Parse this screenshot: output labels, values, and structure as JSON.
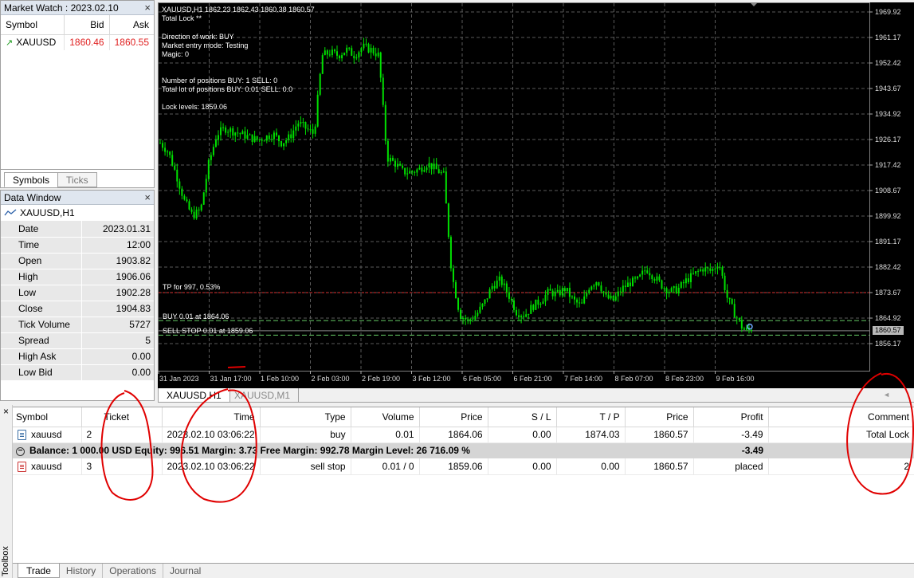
{
  "market_watch": {
    "title": "Market Watch : 2023.02.10",
    "columns": [
      "Symbol",
      "Bid",
      "Ask"
    ],
    "rows": [
      {
        "symbol": "XAUUSD",
        "bid": "1860.46",
        "ask": "1860.55"
      }
    ],
    "tabs": [
      "Symbols",
      "Ticks"
    ]
  },
  "data_window": {
    "title": "Data Window",
    "symbol": "XAUUSD,H1",
    "rows": [
      {
        "key": "Date",
        "value": "2023.01.31"
      },
      {
        "key": "Time",
        "value": "12:00"
      },
      {
        "key": "Open",
        "value": "1903.82"
      },
      {
        "key": "High",
        "value": "1906.06"
      },
      {
        "key": "Low",
        "value": "1902.28"
      },
      {
        "key": "Close",
        "value": "1904.83"
      },
      {
        "key": "Tick Volume",
        "value": "5727"
      },
      {
        "key": "Spread",
        "value": "5"
      },
      {
        "key": "High Ask",
        "value": "0.00"
      },
      {
        "key": "Low Bid",
        "value": "0.00"
      }
    ]
  },
  "chart": {
    "header": "XAUUSD,H1  1862.23 1862.43 1860.38 1860.57",
    "info": {
      "l1": "Total Lock   **",
      "l2": "Direction of work: BUY",
      "l3": "Market entry mode: Testing",
      "l4": "Magic: 0",
      "l5": "Number of positions    BUY: 1    SELL: 0",
      "l6": "Total lot of positions    BUY: 0.01    SELL: 0.0",
      "l7": "Lock levels: 1859.06"
    },
    "levels": {
      "tp": "TP for 997, 0.53%",
      "buy": "BUY 0.01 at 1864.06",
      "sell": "SELL STOP 0.01 at 1859.06",
      "current": "1860.57"
    },
    "tabs": [
      "XAUUSD,H1",
      "XAUUSD,M1"
    ]
  },
  "chart_data": {
    "type": "candlestick",
    "y_ticks": [
      "1969.92",
      "1961.17",
      "1952.42",
      "1943.67",
      "1934.92",
      "1926.17",
      "1917.42",
      "1908.67",
      "1899.92",
      "1891.17",
      "1882.42",
      "1873.67",
      "1864.92",
      "1856.17"
    ],
    "x_ticks": [
      "31 Jan 2023",
      "31 Jan 17:00",
      "1 Feb 10:00",
      "2 Feb 03:00",
      "2 Feb 19:00",
      "3 Feb 12:00",
      "6 Feb 05:00",
      "6 Feb 21:00",
      "7 Feb 14:00",
      "8 Feb 07:00",
      "8 Feb 23:00",
      "9 Feb 16:00"
    ],
    "ylim": [
      1852,
      1973
    ],
    "close_path": [
      1925,
      1922,
      1914,
      1905,
      1900,
      1902,
      1918,
      1928,
      1930,
      1929,
      1928,
      1927,
      1926,
      1927,
      1928,
      1925,
      1927,
      1932,
      1930,
      1928,
      1955,
      1956,
      1955,
      1957,
      1955,
      1958,
      1957,
      1955,
      1920,
      1918,
      1915,
      1915,
      1916,
      1918,
      1916,
      1914,
      1880,
      1866,
      1864,
      1866,
      1870,
      1876,
      1878,
      1873,
      1867,
      1866,
      1869,
      1871,
      1874,
      1873,
      1875,
      1871,
      1869,
      1876,
      1878,
      1872,
      1871,
      1875,
      1877,
      1878,
      1882,
      1879,
      1876,
      1874,
      1875,
      1878,
      1880,
      1882,
      1881,
      1884,
      1872,
      1866,
      1861,
      1860.57
    ],
    "series": [
      {
        "name": "XAUUSD,H1"
      }
    ]
  },
  "trade": {
    "columns": [
      "Symbol",
      "Ticket",
      "Time",
      "Type",
      "Volume",
      "Price",
      "S / L",
      "T / P",
      "Price",
      "Profit",
      "Comment"
    ],
    "rows": [
      {
        "symbol": "xauusd",
        "ticket": "2",
        "time": "2023.02.10 03:06:22",
        "type": "buy",
        "volume": "0.01",
        "price": "1864.06",
        "sl": "0.00",
        "tp": "1874.03",
        "cur": "1860.57",
        "profit": "-3.49",
        "comment": "Total Lock"
      }
    ],
    "balance": "Balance: 1 000.00 USD  Equity: 996.51  Margin: 3.73  Free Margin: 992.78  Margin Level: 26 716.09 %",
    "balance_profit": "-3.49",
    "orders": [
      {
        "symbol": "xauusd",
        "ticket": "3",
        "time": "2023.02.10 03:06:22",
        "type": "sell stop",
        "volume": "0.01 / 0",
        "price": "1859.06",
        "sl": "0.00",
        "tp": "0.00",
        "cur": "1860.57",
        "profit": "placed",
        "comment": "2"
      }
    ],
    "tabs": [
      "Trade",
      "History",
      "Operations",
      "Journal"
    ],
    "toolbox": "Toolbox"
  },
  "colors": {
    "candle": "#00e000",
    "tp_line": "#e03030",
    "level_line": "#66cc66",
    "annotation": "#e00000"
  }
}
